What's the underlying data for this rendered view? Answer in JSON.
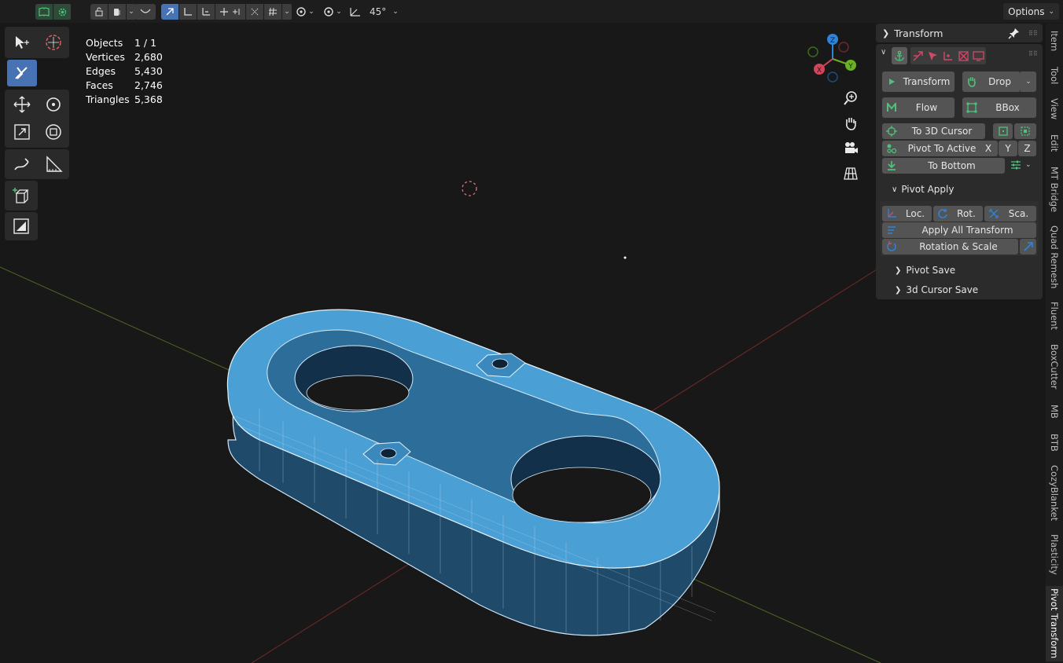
{
  "header": {
    "view_angle": "45°",
    "options_label": "Options",
    "colors": {
      "active": "#4772b3",
      "button": "#3d3d3d"
    }
  },
  "toolbar": {
    "tools": [
      "select-box",
      "cursor",
      "tweak-active",
      "move",
      "rotate",
      "scale",
      "transform",
      "annotate",
      "measure",
      "add-cube",
      "extra-tool"
    ]
  },
  "stats": [
    {
      "label": "Objects",
      "value": "1 / 1"
    },
    {
      "label": "Vertices",
      "value": "2,680"
    },
    {
      "label": "Edges",
      "value": "5,430"
    },
    {
      "label": "Faces",
      "value": "2,746"
    },
    {
      "label": "Triangles",
      "value": "5,368"
    }
  ],
  "gizmo": {
    "x": "X",
    "y": "Y",
    "z": "Z"
  },
  "panel": {
    "transform_header": "Transform",
    "buttons": {
      "transform": "Transform",
      "drop": "Drop",
      "flow": "Flow",
      "bbox": "BBox",
      "to_3d_cursor": "To 3D Cursor",
      "pivot_to_active": "Pivot To Active",
      "axis_x": "X",
      "axis_y": "Y",
      "axis_z": "Z",
      "to_bottom": "To Bottom",
      "loc": "Loc.",
      "rot": "Rot.",
      "sca": "Sca.",
      "apply_all": "Apply All Transform",
      "rotation_scale": "Rotation & Scale"
    },
    "pivot_apply": "Pivot Apply",
    "pivot_save": "Pivot Save",
    "cursor_save": "3d Cursor Save"
  },
  "tabs": [
    "Item",
    "Tool",
    "View",
    "Edit",
    "MT Bridge",
    "Quad Remesh",
    "Fluent",
    "BoxCutter",
    "MB",
    "BTB",
    "CozyBlanket",
    "Plasticity",
    "Pivot Transform"
  ],
  "active_tab": "Pivot Transform"
}
